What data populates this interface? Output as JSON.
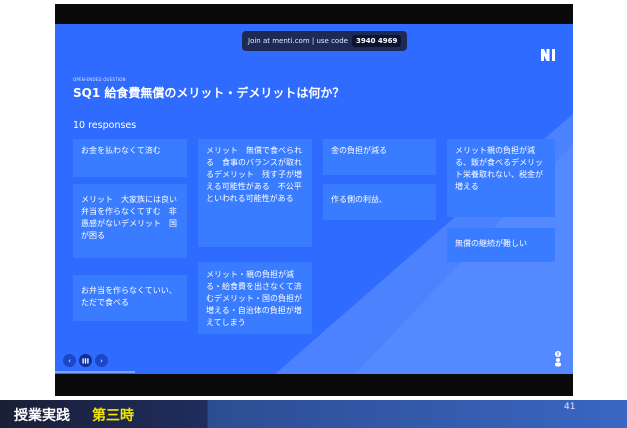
{
  "menti": {
    "join_text": "Join at menti.com | use code",
    "code": "3940 4969",
    "question_type": "OPEN-ENDED QUESTION",
    "question": "SQ1 給食費無償のメリット・デメリットは何か？",
    "responses_count": "10 responses",
    "cards": [
      "お金を払わなくて済む",
      "メリット　大家族には良い　弁当を作らなくてすむ　非愚感がないデメリット　国が困る",
      "お弁当を作らなくていい、ただで食べる",
      "メリット　無償で食べられる　食事のバランスが取れるデメリット　残す子が増える可能性がある　不公平といわれる可能性がある",
      "メリット・親の負担が減る・給食費を出さなくて済むデメリット・国の負担が増える・自治体の負担が増えてしまう",
      "金の負担が減る",
      "作る側の利益、",
      "メリット親の負担が減る、飯が食べるデメリット栄養取れない、税金が増える",
      "無償の継続が難しい"
    ],
    "people_count": "0"
  },
  "footer": {
    "title": "授業実践",
    "subtitle": "第三時",
    "page_number": "41"
  },
  "colors": {
    "slide_bg": "#2f6bff",
    "card_bg": "#3a7cff",
    "accent_yellow": "#f5e600"
  }
}
